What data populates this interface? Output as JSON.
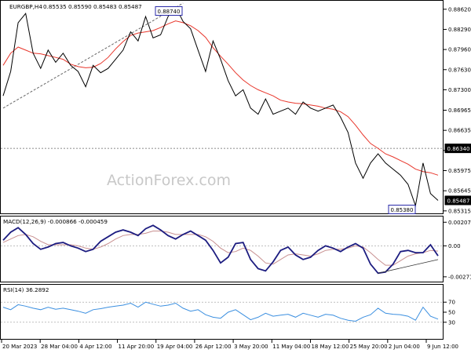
{
  "header": {
    "symbol": "EURGBP,H4",
    "quote": "0.85535 0.85590 0.85483 0.85487"
  },
  "watermark": "ActionForex.com",
  "colors": {
    "price": "#000000",
    "sma": "#e8362b",
    "macd": "#1c1c80",
    "signal": "#c89090",
    "rsi": "#3b8fe0",
    "trendline": "#666666",
    "label_border": "#2a2aa8"
  },
  "chart_data": [
    {
      "type": "line",
      "title": "EURGBP,H4",
      "ylim": [
        0.853,
        0.8872
      ],
      "y_ticks": [
        "0.88620",
        "0.88290",
        "0.87960",
        "0.87630",
        "0.87300",
        "0.86965",
        "0.86635",
        "0.86305",
        "0.85975",
        "0.85645",
        "0.85315"
      ],
      "y_tick_values": [
        0.8862,
        0.8829,
        0.8796,
        0.8763,
        0.873,
        0.86965,
        0.86635,
        0.86305,
        0.85975,
        0.85645,
        0.85315
      ],
      "x_ticks": [
        "20 Mar 2023",
        "28 Mar 04:00",
        "4 Apr 12:00",
        "11 Apr 20:00",
        "19 Apr 04:00",
        "26 Apr 12:00",
        "3 May 20:00",
        "11 May 04:00",
        "18 May 12:00",
        "25 May 20:00",
        "2 Jun 04:00",
        "9 Jun 12:00"
      ],
      "series": [
        {
          "values": [
            0.872,
            0.876,
            0.884,
            0.8855,
            0.879,
            0.8765,
            0.8795,
            0.8775,
            0.879,
            0.877,
            0.876,
            0.8735,
            0.877,
            0.8758,
            0.8765,
            0.878,
            0.8795,
            0.8825,
            0.881,
            0.885,
            0.8815,
            0.882,
            0.885,
            0.8866,
            0.8842,
            0.883,
            0.8795,
            0.876,
            0.881,
            0.878,
            0.8745,
            0.872,
            0.873,
            0.87,
            0.869,
            0.8715,
            0.869,
            0.8695,
            0.87,
            0.869,
            0.871,
            0.87,
            0.8695,
            0.87,
            0.8705,
            0.8685,
            0.866,
            0.861,
            0.8585,
            0.861,
            0.8625,
            0.861,
            0.86,
            0.859,
            0.8575,
            0.854,
            0.861,
            0.856,
            0.85487
          ]
        },
        {
          "values": [
            0.877,
            0.879,
            0.88,
            0.8795,
            0.879,
            0.8789,
            0.8786,
            0.8783,
            0.878,
            0.8772,
            0.8768,
            0.8766,
            0.8767,
            0.8773,
            0.8783,
            0.8797,
            0.8809,
            0.8819,
            0.8823,
            0.8825,
            0.8827,
            0.8832,
            0.8838,
            0.8843,
            0.884,
            0.8835,
            0.8827,
            0.8816,
            0.8799,
            0.8785,
            0.8772,
            0.8758,
            0.8746,
            0.8737,
            0.873,
            0.8725,
            0.872,
            0.8713,
            0.871,
            0.8708,
            0.8707,
            0.8705,
            0.8703,
            0.87,
            0.8698,
            0.8694,
            0.8686,
            0.8672,
            0.8656,
            0.8642,
            0.8634,
            0.8625,
            0.862,
            0.8614,
            0.8608,
            0.86,
            0.8596,
            0.8594,
            0.859
          ]
        }
      ],
      "annotations": [
        {
          "text": "0.88740",
          "value": 0.8874
        },
        {
          "text": "0.85380",
          "value": 0.8538
        },
        {
          "text": "0.86340",
          "value": 0.8634
        },
        {
          "text": "0.85487",
          "value": 0.85487
        }
      ]
    },
    {
      "type": "line",
      "title": "MACD(12,26,9) -0.000866 -0.000459",
      "ylim": [
        -0.003,
        0.0023
      ],
      "y_ticks": [
        "0.002074",
        "0.00",
        "-0.002716"
      ],
      "y_tick_values": [
        0.002074,
        0.0,
        -0.002716
      ],
      "series": [
        {
          "values": [
            0.0005,
            0.0012,
            0.0016,
            0.001,
            0.0002,
            -0.0003,
            -0.0001,
            0.0002,
            0.0003,
            0.0,
            -0.0002,
            -0.0005,
            -0.0003,
            0.0004,
            0.0008,
            0.0012,
            0.0014,
            0.0012,
            0.0009,
            0.0015,
            0.0018,
            0.0014,
            0.0009,
            0.0006,
            0.001,
            0.0013,
            0.0009,
            0.0005,
            -0.0004,
            -0.0015,
            -0.001,
            0.0002,
            0.0003,
            -0.0012,
            -0.002,
            -0.0022,
            -0.0014,
            -0.0004,
            -0.0001,
            -0.0008,
            -0.0012,
            -0.001,
            -0.0004,
            0.0,
            -0.0002,
            -0.0005,
            -0.0001,
            0.0002,
            -0.0002,
            -0.0016,
            -0.0024,
            -0.0023,
            -0.0016,
            -0.0005,
            -0.0004,
            -0.0006,
            -0.0006,
            0.0001,
            -0.00087
          ]
        },
        {
          "values": [
            0.0003,
            0.0006,
            0.0009,
            0.001,
            0.0008,
            0.0004,
            0.0001,
            0.0001,
            0.0001,
            0.0001,
            0.0,
            -0.0002,
            -0.0003,
            -0.0001,
            0.0002,
            0.0006,
            0.0009,
            0.001,
            0.001,
            0.0011,
            0.0013,
            0.0013,
            0.0012,
            0.001,
            0.001,
            0.001,
            0.001,
            0.0008,
            0.0004,
            -0.0002,
            -0.0006,
            -0.0005,
            -0.0002,
            -0.0004,
            -0.0009,
            -0.0015,
            -0.0016,
            -0.0012,
            -0.0008,
            -0.0007,
            -0.0008,
            -0.0009,
            -0.0007,
            -0.0004,
            -0.0003,
            -0.0003,
            -0.0002,
            0.0,
            -0.0001,
            -0.0006,
            -0.0012,
            -0.0017,
            -0.0017,
            -0.0013,
            -0.0009,
            -0.0007,
            -0.0006,
            -0.0004,
            -0.00046
          ]
        }
      ]
    },
    {
      "type": "line",
      "title": "RSI(14) 36.2892",
      "ylim": [
        0,
        100
      ],
      "y_ticks": [
        "70",
        "50",
        "30"
      ],
      "y_tick_values": [
        70,
        50,
        30
      ],
      "series": [
        {
          "values": [
            60,
            55,
            65,
            62,
            58,
            55,
            60,
            56,
            58,
            55,
            52,
            48,
            55,
            57,
            60,
            62,
            64,
            68,
            60,
            70,
            66,
            62,
            64,
            68,
            58,
            52,
            55,
            45,
            40,
            38,
            50,
            55,
            45,
            35,
            40,
            48,
            42,
            44,
            46,
            40,
            48,
            44,
            40,
            46,
            44,
            38,
            34,
            32,
            40,
            45,
            58,
            48,
            46,
            45,
            42,
            34,
            60,
            42,
            36.2892
          ]
        }
      ]
    }
  ]
}
